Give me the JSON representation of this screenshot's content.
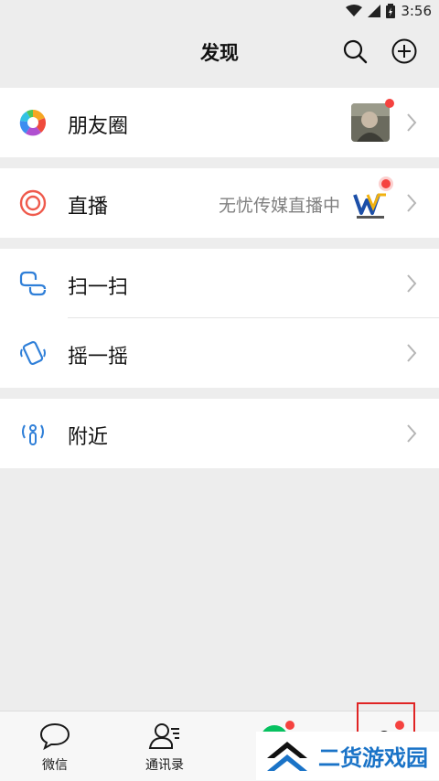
{
  "status_bar": {
    "time": "3:56"
  },
  "header": {
    "title": "发现"
  },
  "moments": {
    "label": "朋友圈"
  },
  "live": {
    "label": "直播",
    "subtext": "无忧传媒直播中"
  },
  "scan": {
    "label": "扫一扫"
  },
  "shake": {
    "label": "摇一摇"
  },
  "nearby": {
    "label": "附近"
  },
  "tabs": [
    {
      "label": "微信"
    },
    {
      "label": "通讯录"
    },
    {
      "label": ""
    },
    {
      "label": ""
    }
  ],
  "watermark": {
    "text": "二货游戏园"
  },
  "colors": {
    "accent_green": "#07c160",
    "badge_red": "#f5423f",
    "icon_blue": "#2f7fd8"
  }
}
